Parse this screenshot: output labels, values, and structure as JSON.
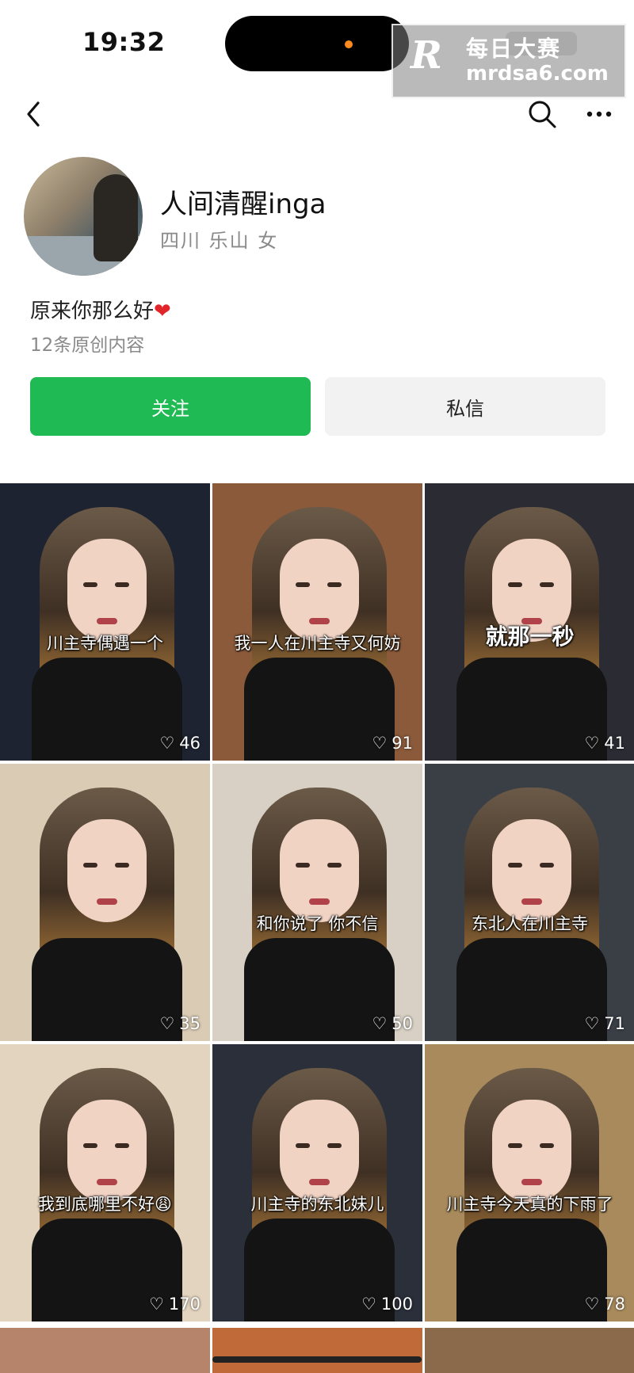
{
  "status_bar": {
    "time": "19:32"
  },
  "watermark": {
    "logo": "R",
    "title": "每日大赛",
    "url": "mrdsa6.com"
  },
  "profile": {
    "name": "人间清醒inga",
    "location": "四川 乐山 女",
    "bio": "原来你那么好",
    "bio_emoji": "❤",
    "content_count": "12条原创内容",
    "follow_label": "关注",
    "message_label": "私信"
  },
  "videos": [
    {
      "caption": "川主寺偶遇一个",
      "likes": "46",
      "bg": "#1d2330",
      "big": false
    },
    {
      "caption": "我一人在川主寺又何妨",
      "likes": "91",
      "bg": "#8a5a3a",
      "big": false
    },
    {
      "caption": "就那一秒",
      "likes": "41",
      "bg": "#2b2b33",
      "big": true
    },
    {
      "caption": "",
      "likes": "35",
      "bg": "#d9cbb4",
      "big": false
    },
    {
      "caption": "和你说了 你不信",
      "likes": "50",
      "bg": "#d8d0c4",
      "big": false
    },
    {
      "caption": "东北人在川主寺",
      "likes": "71",
      "bg": "#3a3f46",
      "big": false
    },
    {
      "caption": "我到底哪里不好😩",
      "likes": "170",
      "bg": "#e3d4bf",
      "big": false
    },
    {
      "caption": "川主寺的东北妹儿",
      "likes": "100",
      "bg": "#2a2f3a",
      "big": false
    },
    {
      "caption": "川主寺今天真的下雨了",
      "likes": "78",
      "bg": "#a88a5c",
      "big": false
    }
  ],
  "colors": {
    "follow_green": "#1fba53",
    "dm_gray": "#f2f2f2"
  },
  "icons": {
    "back": "back-icon",
    "search": "search-icon",
    "more": "more-icon",
    "heart": "heart-icon"
  }
}
